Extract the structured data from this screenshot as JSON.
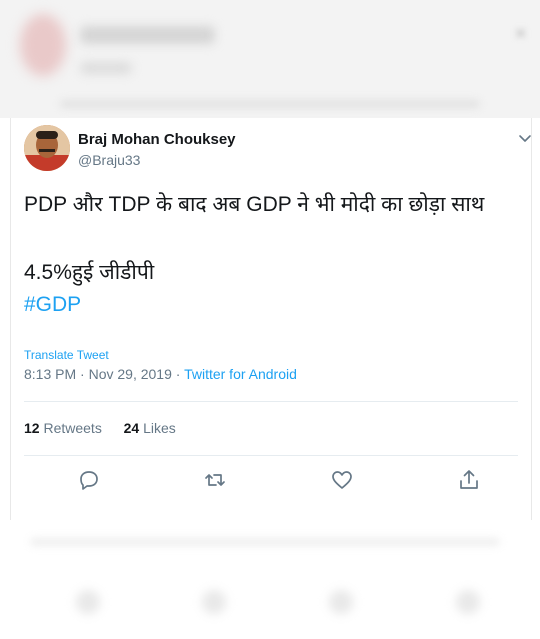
{
  "tweet": {
    "author_name": "Braj Mohan Chouksey",
    "handle": "@Braju33",
    "text_line1": "PDP और TDP के बाद अब GDP ने भी मोदी का  छोड़ा साथ",
    "text_line2": "4.5%हुई जीडीपी",
    "hashtag": "#GDP",
    "translate_label": "Translate Tweet",
    "time": "8:13 PM · Nov 29, 2019 · ",
    "source": "Twitter for Android",
    "retweet_count": "12",
    "retweet_label": " Retweets",
    "like_count": "24",
    "like_label": " Likes"
  },
  "colors": {
    "link": "#1da1f2",
    "secondary_text": "#657786",
    "primary_text": "#14171a"
  },
  "icons": [
    "chevron-down-icon",
    "reply-icon",
    "retweet-icon",
    "like-icon",
    "share-icon"
  ]
}
